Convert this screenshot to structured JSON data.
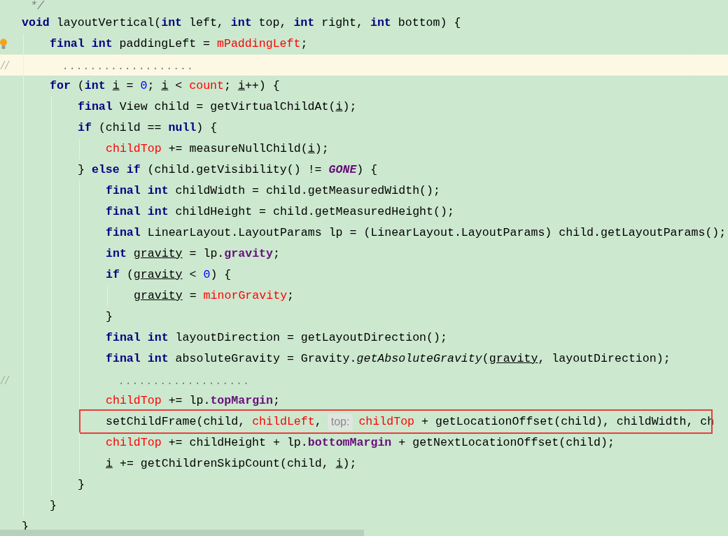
{
  "editor": {
    "lines": [
      {
        "kind": "code",
        "bulb": false,
        "current": false,
        "boxed": false,
        "tokens": [
          {
            "text": "*/",
            "kind": "comment"
          }
        ]
      },
      {
        "kind": "code",
        "bulb": false,
        "current": false,
        "boxed": false,
        "tokens": [
          {
            "text": "void",
            "kind": "keyword"
          },
          {
            "text": " layoutVertical(",
            "kind": "plain"
          },
          {
            "text": "int",
            "kind": "keyword"
          },
          {
            "text": " left, ",
            "kind": "plain"
          },
          {
            "text": "int",
            "kind": "keyword"
          },
          {
            "text": " top, ",
            "kind": "plain"
          },
          {
            "text": "int",
            "kind": "keyword"
          },
          {
            "text": " right, ",
            "kind": "plain"
          },
          {
            "text": "int",
            "kind": "keyword"
          },
          {
            "text": " bottom) {",
            "kind": "plain"
          }
        ],
        "children": [
          {
            "kind": "code",
            "bulb": true,
            "current": false,
            "boxed": false,
            "tokens": [
              {
                "text": "final int",
                "kind": "keyword"
              },
              {
                "text": " paddingLeft = ",
                "kind": "plain"
              },
              {
                "text": "mPaddingLeft",
                "kind": "field"
              },
              {
                "text": ";",
                "kind": "plain"
              }
            ]
          },
          {
            "kind": "folded",
            "bulb": false,
            "current": true,
            "boxed": false,
            "tokens": [
              {
                "text": "...................",
                "kind": "fold"
              }
            ]
          },
          {
            "kind": "code",
            "bulb": false,
            "current": false,
            "boxed": false,
            "tokens": [
              {
                "text": "for",
                "kind": "keyword"
              },
              {
                "text": " (",
                "kind": "plain"
              },
              {
                "text": "int ",
                "kind": "keyword"
              },
              {
                "text": "i",
                "kind": "reassigned"
              },
              {
                "text": " = ",
                "kind": "plain"
              },
              {
                "text": "0",
                "kind": "number"
              },
              {
                "text": "; ",
                "kind": "plain"
              },
              {
                "text": "i",
                "kind": "reassigned"
              },
              {
                "text": " < ",
                "kind": "plain"
              },
              {
                "text": "count",
                "kind": "field"
              },
              {
                "text": "; ",
                "kind": "plain"
              },
              {
                "text": "i",
                "kind": "reassigned"
              },
              {
                "text": "++) {",
                "kind": "plain"
              }
            ],
            "children": [
              {
                "kind": "code",
                "bulb": false,
                "current": false,
                "boxed": false,
                "tokens": [
                  {
                    "text": "final",
                    "kind": "keyword"
                  },
                  {
                    "text": " View child = getVirtualChildAt(",
                    "kind": "plain"
                  },
                  {
                    "text": "i",
                    "kind": "reassigned"
                  },
                  {
                    "text": ");",
                    "kind": "plain"
                  }
                ]
              },
              {
                "kind": "code",
                "bulb": false,
                "current": false,
                "boxed": false,
                "tokens": [
                  {
                    "text": "if",
                    "kind": "keyword"
                  },
                  {
                    "text": " (child == ",
                    "kind": "plain"
                  },
                  {
                    "text": "null",
                    "kind": "keyword"
                  },
                  {
                    "text": ") {",
                    "kind": "plain"
                  }
                ],
                "children": [
                  {
                    "kind": "code",
                    "bulb": false,
                    "current": false,
                    "boxed": false,
                    "tokens": [
                      {
                        "text": "childTop",
                        "kind": "field"
                      },
                      {
                        "text": " += measureNullChild(",
                        "kind": "plain"
                      },
                      {
                        "text": "i",
                        "kind": "reassigned"
                      },
                      {
                        "text": ");",
                        "kind": "plain"
                      }
                    ]
                  }
                ]
              },
              {
                "kind": "code",
                "bulb": false,
                "current": false,
                "boxed": false,
                "tokens": [
                  {
                    "text": "} ",
                    "kind": "plain"
                  },
                  {
                    "text": "else if",
                    "kind": "keyword"
                  },
                  {
                    "text": " (child.getVisibility() != ",
                    "kind": "plain"
                  },
                  {
                    "text": "GONE",
                    "kind": "constant"
                  },
                  {
                    "text": ") {",
                    "kind": "plain"
                  }
                ],
                "children": [
                  {
                    "kind": "code",
                    "bulb": false,
                    "current": false,
                    "boxed": false,
                    "tokens": [
                      {
                        "text": "final int",
                        "kind": "keyword"
                      },
                      {
                        "text": " childWidth = child.getMeasuredWidth();",
                        "kind": "plain"
                      }
                    ]
                  },
                  {
                    "kind": "code",
                    "bulb": false,
                    "current": false,
                    "boxed": false,
                    "tokens": [
                      {
                        "text": "final int",
                        "kind": "keyword"
                      },
                      {
                        "text": " childHeight = child.getMeasuredHeight();",
                        "kind": "plain"
                      }
                    ]
                  },
                  {
                    "kind": "code",
                    "bulb": false,
                    "current": false,
                    "boxed": false,
                    "tokens": [
                      {
                        "text": "final",
                        "kind": "keyword"
                      },
                      {
                        "text": " LinearLayout.LayoutParams lp = (LinearLayout.LayoutParams) child.getLayoutParams();",
                        "kind": "plain"
                      }
                    ]
                  },
                  {
                    "kind": "code",
                    "bulb": false,
                    "current": false,
                    "boxed": false,
                    "tokens": [
                      {
                        "text": "int ",
                        "kind": "keyword"
                      },
                      {
                        "text": "gravity",
                        "kind": "reassigned"
                      },
                      {
                        "text": " = lp.",
                        "kind": "plain"
                      },
                      {
                        "text": "gravity",
                        "kind": "member"
                      },
                      {
                        "text": ";",
                        "kind": "plain"
                      }
                    ]
                  },
                  {
                    "kind": "code",
                    "bulb": false,
                    "current": false,
                    "boxed": false,
                    "tokens": [
                      {
                        "text": "if",
                        "kind": "keyword"
                      },
                      {
                        "text": " (",
                        "kind": "plain"
                      },
                      {
                        "text": "gravity",
                        "kind": "reassigned"
                      },
                      {
                        "text": " < ",
                        "kind": "plain"
                      },
                      {
                        "text": "0",
                        "kind": "number"
                      },
                      {
                        "text": ") {",
                        "kind": "plain"
                      }
                    ],
                    "children": [
                      {
                        "kind": "code",
                        "bulb": false,
                        "current": false,
                        "boxed": false,
                        "tokens": [
                          {
                            "text": "gravity",
                            "kind": "reassigned"
                          },
                          {
                            "text": " = ",
                            "kind": "plain"
                          },
                          {
                            "text": "minorGravity",
                            "kind": "field"
                          },
                          {
                            "text": ";",
                            "kind": "plain"
                          }
                        ]
                      }
                    ]
                  },
                  {
                    "kind": "code",
                    "bulb": false,
                    "current": false,
                    "boxed": false,
                    "tokens": [
                      {
                        "text": "}",
                        "kind": "plain"
                      }
                    ]
                  },
                  {
                    "kind": "code",
                    "bulb": false,
                    "current": false,
                    "boxed": false,
                    "tokens": [
                      {
                        "text": "final int",
                        "kind": "keyword"
                      },
                      {
                        "text": " layoutDirection = getLayoutDirection();",
                        "kind": "plain"
                      }
                    ]
                  },
                  {
                    "kind": "code",
                    "bulb": false,
                    "current": false,
                    "boxed": false,
                    "tokens": [
                      {
                        "text": "final int",
                        "kind": "keyword"
                      },
                      {
                        "text": " absoluteGravity = Gravity.",
                        "kind": "plain"
                      },
                      {
                        "text": "getAbsoluteGravity",
                        "kind": "static"
                      },
                      {
                        "text": "(",
                        "kind": "plain"
                      },
                      {
                        "text": "gravity",
                        "kind": "reassigned"
                      },
                      {
                        "text": ", layoutDirection);",
                        "kind": "plain"
                      }
                    ]
                  },
                  {
                    "kind": "folded",
                    "bulb": false,
                    "current": false,
                    "boxed": false,
                    "tokens": [
                      {
                        "text": "...................",
                        "kind": "fold"
                      }
                    ]
                  },
                  {
                    "kind": "code",
                    "bulb": false,
                    "current": false,
                    "boxed": false,
                    "tokens": [
                      {
                        "text": "childTop",
                        "kind": "field"
                      },
                      {
                        "text": " += lp.",
                        "kind": "plain"
                      },
                      {
                        "text": "topMargin",
                        "kind": "member"
                      },
                      {
                        "text": ";",
                        "kind": "plain"
                      }
                    ]
                  },
                  {
                    "kind": "code",
                    "bulb": false,
                    "current": false,
                    "boxed": true,
                    "tokens": [
                      {
                        "text": "setChildFrame(child, ",
                        "kind": "plain"
                      },
                      {
                        "text": "childLeft",
                        "kind": "field"
                      },
                      {
                        "text": ",",
                        "kind": "plain"
                      },
                      {
                        "text": "top:",
                        "kind": "hint"
                      },
                      {
                        "text": "childTop",
                        "kind": "field"
                      },
                      {
                        "text": " + getLocationOffset(child), childWidth, ch",
                        "kind": "plain"
                      }
                    ]
                  },
                  {
                    "kind": "code",
                    "bulb": false,
                    "current": false,
                    "boxed": false,
                    "tokens": [
                      {
                        "text": "childTop",
                        "kind": "field"
                      },
                      {
                        "text": " += childHeight + lp.",
                        "kind": "plain"
                      },
                      {
                        "text": "bottomMargin",
                        "kind": "member"
                      },
                      {
                        "text": " + getNextLocationOffset(child);",
                        "kind": "plain"
                      }
                    ]
                  },
                  {
                    "kind": "code",
                    "bulb": false,
                    "current": false,
                    "boxed": false,
                    "tokens": [
                      {
                        "text": "i",
                        "kind": "reassigned"
                      },
                      {
                        "text": " += getChildrenSkipCount(child, ",
                        "kind": "plain"
                      },
                      {
                        "text": "i",
                        "kind": "reassigned"
                      },
                      {
                        "text": ");",
                        "kind": "plain"
                      }
                    ]
                  }
                ]
              },
              {
                "kind": "code",
                "bulb": false,
                "current": false,
                "boxed": false,
                "tokens": [
                  {
                    "text": "}",
                    "kind": "plain"
                  }
                ]
              }
            ]
          },
          {
            "kind": "code",
            "bulb": false,
            "current": false,
            "boxed": false,
            "tokens": [
              {
                "text": "}",
                "kind": "plain"
              }
            ]
          }
        ]
      },
      {
        "kind": "code",
        "bulb": false,
        "current": false,
        "boxed": false,
        "tokens": [
          {
            "text": "}",
            "kind": "plain"
          }
        ]
      }
    ]
  }
}
